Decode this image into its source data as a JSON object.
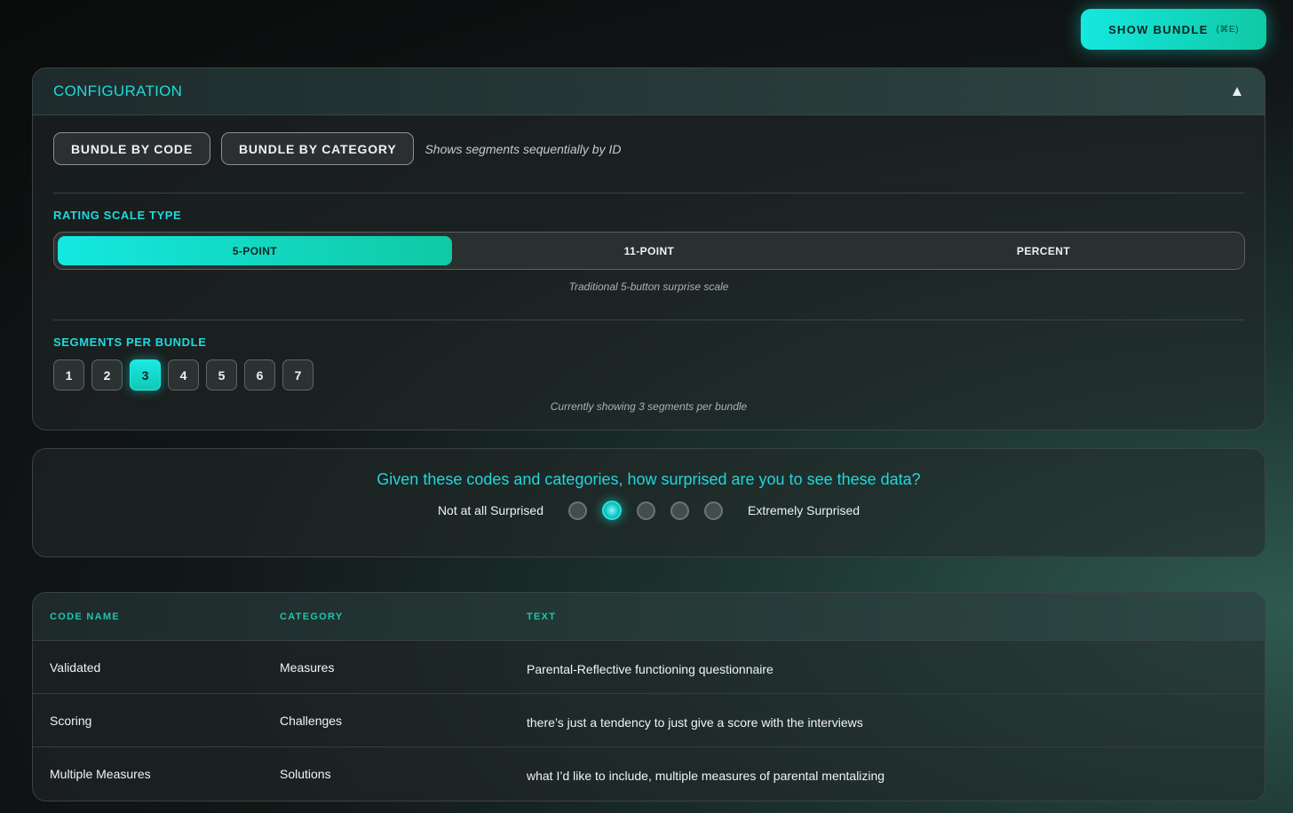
{
  "header": {
    "show_bundle_label": "SHOW BUNDLE",
    "show_bundle_shortcut": "(⌘E)"
  },
  "config": {
    "title": "CONFIGURATION",
    "collapse_icon": "triangle-up-icon",
    "bundle_by_code_label": "BUNDLE BY CODE",
    "bundle_by_category_label": "BUNDLE BY CATEGORY",
    "bundle_hint": "Shows segments sequentially by ID",
    "rating_scale_label": "RATING SCALE TYPE",
    "scale_options": [
      "5-POINT",
      "11-POINT",
      "PERCENT"
    ],
    "scale_selected": "5-POINT",
    "scale_caption": "Traditional 5-button surprise scale",
    "segments_label": "SEGMENTS PER BUNDLE",
    "segments_options": [
      "1",
      "2",
      "3",
      "4",
      "5",
      "6",
      "7"
    ],
    "segments_selected": "3",
    "segments_caption": "Currently showing 3 segments per bundle"
  },
  "question": {
    "text": "Given these codes and categories, how surprised are you to see these data?",
    "low_label": "Not at all Surprised",
    "high_label": "Extremely Surprised",
    "options_count": 5,
    "selected_index": 2
  },
  "table": {
    "headers": [
      "CODE NAME",
      "CATEGORY",
      "TEXT"
    ],
    "rows": [
      [
        "Validated",
        "Measures",
        "Parental-Reflective functioning questionnaire"
      ],
      [
        "Scoring",
        "Challenges",
        "there’s just a tendency to just give a score with the interviews"
      ],
      [
        "Multiple Measures",
        "Solutions",
        "what I’d like to include, multiple measures of parental mentalizing"
      ]
    ]
  },
  "colors": {
    "accent": "#14e8e0",
    "accent_secondary": "#10c9a4",
    "header_text": "#17c9ab"
  }
}
